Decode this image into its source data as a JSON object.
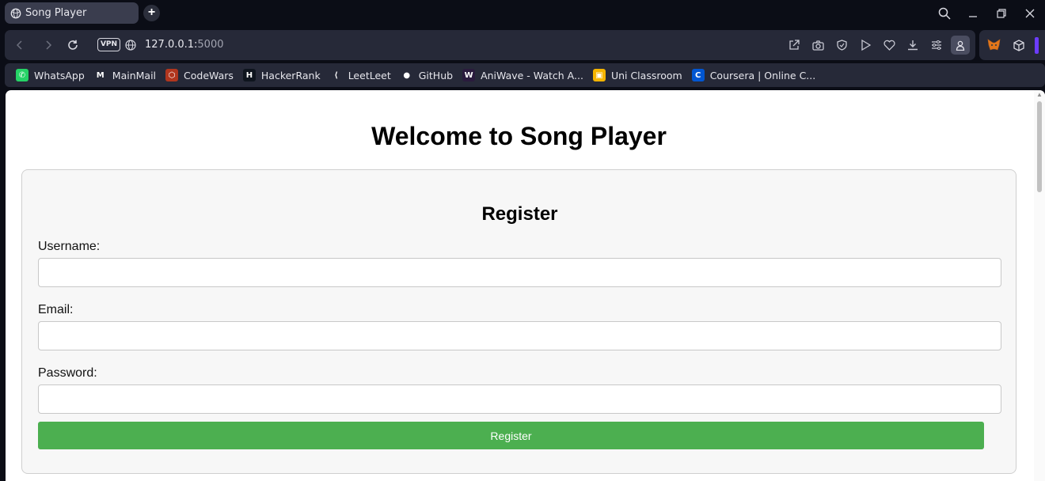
{
  "browser": {
    "tab_title": "Song Player",
    "new_tab_label": "+",
    "vpn_label": "VPN",
    "url_host": "127.0.0.1:",
    "url_port": "5000"
  },
  "bookmarks": [
    {
      "label": "WhatsApp",
      "icon": "whatsapp-icon",
      "color": "#25d366",
      "glyph": "✆"
    },
    {
      "label": "MainMail",
      "icon": "gmail-icon",
      "color": "#262938",
      "glyph": "M"
    },
    {
      "label": "CodeWars",
      "icon": "codewars-icon",
      "color": "#b1361e",
      "glyph": "⬡"
    },
    {
      "label": "HackerRank",
      "icon": "hackerrank-icon",
      "color": "#0e141e",
      "glyph": "H"
    },
    {
      "label": "LeetLeet",
      "icon": "leetcode-icon",
      "color": "#262938",
      "glyph": "⟨"
    },
    {
      "label": "GitHub",
      "icon": "github-icon",
      "color": "#262938",
      "glyph": "●"
    },
    {
      "label": "AniWave - Watch A...",
      "icon": "aniwave-icon",
      "color": "#2a1b3d",
      "glyph": "W"
    },
    {
      "label": "Uni Classroom",
      "icon": "classroom-icon",
      "color": "#f4b400",
      "glyph": "▣"
    },
    {
      "label": "Coursera | Online C...",
      "icon": "coursera-icon",
      "color": "#0056d2",
      "glyph": "C"
    }
  ],
  "page": {
    "heading": "Welcome to Song Player",
    "form": {
      "title": "Register",
      "username_label": "Username:",
      "username_value": "",
      "email_label": "Email:",
      "email_value": "",
      "password_label": "Password:",
      "password_value": "",
      "submit_label": "Register"
    }
  },
  "colors": {
    "accent_button": "#4caf50",
    "browser_chrome": "#262938",
    "extension_accent": "#6c3cff"
  }
}
